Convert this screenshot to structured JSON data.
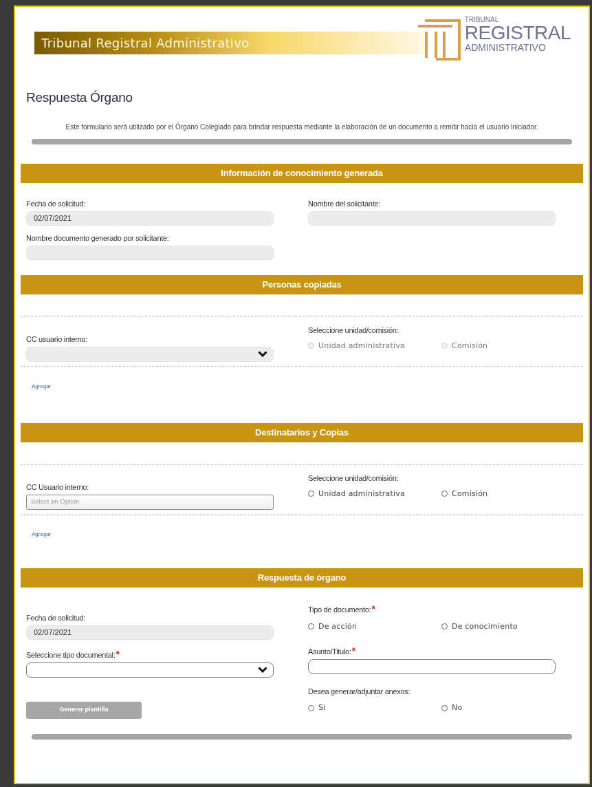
{
  "header": {
    "banner_title": "Tribunal Registral Administrativo",
    "logo_lines": [
      "TRIBUNAL",
      "REGISTRAL",
      "ADMINISTRATIVO"
    ]
  },
  "page_title": "Respuesta Órgano",
  "description": "Este formulario será utilizado por el Órgano Colegiado para brindar respuesta mediante la elaboración de un documento a remitir hacia el usuario iniciador.",
  "info_section": {
    "title": "Información de conocimiento generada",
    "fields": [
      {
        "label": "Fecha de solicitud:",
        "value": "02/07/2021"
      },
      {
        "label": "Nombre del solicitante:"
      },
      {
        "label": "Nombre documento generado por solicitante:"
      }
    ]
  },
  "cc_sections": [
    {
      "title": "Personas copiadas",
      "cc_label": "CC usuario interno:",
      "select": {
        "kind": "dropdown"
      },
      "radio_label": "Seleccione unidad/comisión:",
      "options": [
        {
          "label": "Unidad administrativa",
          "selected": false,
          "disabled": true
        },
        {
          "label": "Comisión",
          "selected": false,
          "disabled": true
        }
      ],
      "add_link": "Agregar"
    },
    {
      "title": "Destinatarios y Copias",
      "cc_label": "CC Usuario interno:",
      "select": {
        "kind": "combo",
        "placeholder": "Select an Option"
      },
      "radio_label": "Seleccione unidad/comisión:",
      "options": [
        {
          "label": "Unidad administrativa",
          "selected": false,
          "disabled": false
        },
        {
          "label": "Comisión",
          "selected": false,
          "disabled": false
        }
      ],
      "add_link": "Agregar"
    }
  ],
  "response_section": {
    "title": "Respuesta de órgano",
    "date_field": {
      "label": "Fecha de solicitud:",
      "value": "02/07/2021"
    },
    "doc_type_select": {
      "label": "Seleccione tipo documental:",
      "required_mark": "*"
    },
    "generate_button": "Generar plantilla",
    "doc_kind": {
      "label": "Tipo de documento:",
      "required_mark": "*",
      "options": [
        {
          "label": "De acción",
          "selected": false
        },
        {
          "label": "De conocimiento",
          "selected": false
        }
      ]
    },
    "subject": {
      "label": "Asunto/Titulo:",
      "required_mark": "*"
    },
    "annexes": {
      "label": "Desea generar/adjuntar anexos:",
      "options": [
        {
          "label": "Si",
          "selected": false
        },
        {
          "label": "No",
          "selected": false
        }
      ]
    }
  }
}
